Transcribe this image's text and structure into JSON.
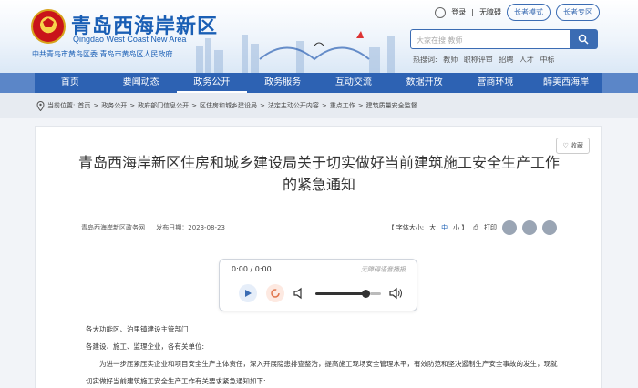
{
  "header": {
    "site_title": "青岛西海岸新区",
    "site_subtitle": "Qingdao West Coast New Area",
    "party_line": "中共青岛市黄岛区委    青岛市黄岛区人民政府",
    "login": "登录",
    "accessibility": "无障碍",
    "elder_mode": "长者模式",
    "elder_zone": "长者专区",
    "search_placeholder": "大家在搜 教师",
    "hot_label": "热搜词:",
    "hot_words": [
      "教师",
      "职称评审",
      "招聘",
      "人才",
      "中标"
    ]
  },
  "nav": {
    "items": [
      "首页",
      "要闻动态",
      "政务公开",
      "政务服务",
      "互动交流",
      "数据开放",
      "营商环境",
      "醉美西海岸"
    ],
    "active_index": 2
  },
  "breadcrumb": {
    "label": "当前位置:",
    "items": [
      "首页",
      "政务公开",
      "政府部门信息公开",
      "区住房和城乡建设局",
      "法定主动公开内容",
      "重点工作",
      "建筑质量安全监督"
    ]
  },
  "article": {
    "favorite": "收藏",
    "title_line1": "青岛西海岸新区住房和城乡建设局关于切实做好当前建筑施工安全生产工作",
    "title_line2": "的紧急通知",
    "source": "青岛西海岸新区政务网",
    "date_label": "发布日期：2023-08-23",
    "font_size_label": "【 字体大小:",
    "font_big": "大",
    "font_mid": "中",
    "font_small": "小 】",
    "print": "打印",
    "paragraphs": [
      "各大功能区、泊里镇建设主管部门",
      "各建设、施工、监理企业，各有关单位:",
      "为进一步压紧压实企业和项目安全生产主体责任，深入开展隐患排查整治，提高施工现场安全管理水平，有效防范和坚决遏制生产安全事故的发生，现就切实做好当前建筑施工安全生产工作有关要求紧急通知如下:"
    ]
  },
  "player": {
    "time": "0:00 / 0:00",
    "note": "无障碍语音播报",
    "volume": 0.82
  }
}
